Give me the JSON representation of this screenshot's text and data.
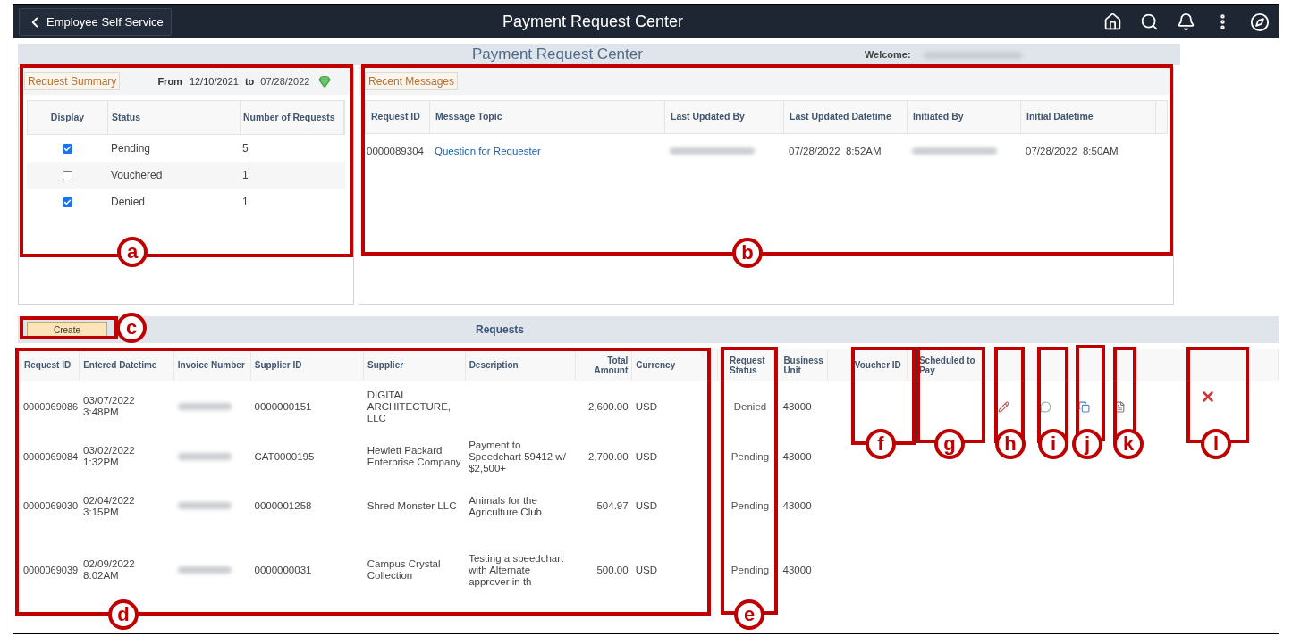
{
  "header": {
    "back_button": "Employee Self Service",
    "title": "Payment Request Center"
  },
  "page_title": "Payment Request Center",
  "welcome_label": "Welcome:",
  "request_summary": {
    "title": "Request Summary",
    "from_label": "From",
    "from_date": "12/10/2021",
    "to_label": "to",
    "to_date": "07/28/2022",
    "columns": [
      "Display",
      "Status",
      "Number of Requests"
    ],
    "rows": [
      {
        "status": "Pending",
        "count": "5",
        "checked": true
      },
      {
        "status": "Vouchered",
        "count": "1",
        "checked": false
      },
      {
        "status": "Denied",
        "count": "1",
        "checked": true
      }
    ]
  },
  "recent_messages": {
    "title": "Recent Messages",
    "columns": [
      "Request ID",
      "Message Topic",
      "Last Updated By",
      "Last Updated Datetime",
      "Initiated By",
      "Initial Datetime"
    ],
    "rows": [
      {
        "request_id": "0000089304",
        "topic": "Question for Requester",
        "last_updated": "07/28/2022  8:52AM",
        "initial": "07/28/2022  8:50AM"
      }
    ]
  },
  "requests": {
    "create_button": "Create",
    "title": "Requests",
    "columns": [
      "Request ID",
      "Entered Datetime",
      "Invoice Number",
      "Supplier ID",
      "Supplier",
      "Description",
      "Total Amount",
      "Currency",
      "Request Status",
      "Business Unit",
      "Voucher ID",
      "Scheduled to Pay"
    ],
    "rows": [
      {
        "request_id": "0000069086",
        "entered": "03/07/2022 3:48PM",
        "supplier_id": "0000000151",
        "supplier": "DIGITAL ARCHITECTURE, LLC",
        "total": "2,600.00",
        "currency": "USD",
        "status": "Denied",
        "business_unit": "43000",
        "actions": true,
        "deletable": true
      },
      {
        "request_id": "0000069084",
        "entered": "03/02/2022 1:32PM",
        "supplier_id": "CAT0000195",
        "supplier": "Hewlett Packard Enterprise Company",
        "description": "Payment to Speedchart 59412 w/ $2,500+",
        "total": "2,700.00",
        "currency": "USD",
        "status": "Pending",
        "business_unit": "43000",
        "actions": false,
        "deletable": false
      },
      {
        "request_id": "0000069030",
        "entered": "02/04/2022 3:15PM",
        "supplier_id": "0000001258",
        "supplier": "Shred Monster LLC",
        "description": "Animals for the Agriculture Club",
        "total": "504.97",
        "currency": "USD",
        "status": "Pending",
        "business_unit": "43000",
        "actions": false,
        "deletable": false
      },
      {
        "request_id": "0000069039",
        "entered": "02/09/2022 8:02AM",
        "supplier_id": "0000000031",
        "supplier": "Campus Crystal Collection",
        "description": "Testing a speedchart with Alternate approver in th",
        "total": "500.00",
        "currency": "USD",
        "status": "Pending",
        "business_unit": "43000",
        "actions": false,
        "deletable": false
      }
    ]
  },
  "annotations": [
    {
      "letter": "a"
    },
    {
      "letter": "b"
    },
    {
      "letter": "c"
    },
    {
      "letter": "d"
    },
    {
      "letter": "e"
    },
    {
      "letter": "f"
    },
    {
      "letter": "g"
    },
    {
      "letter": "h"
    },
    {
      "letter": "i"
    },
    {
      "letter": "j"
    },
    {
      "letter": "k"
    },
    {
      "letter": "l"
    }
  ]
}
